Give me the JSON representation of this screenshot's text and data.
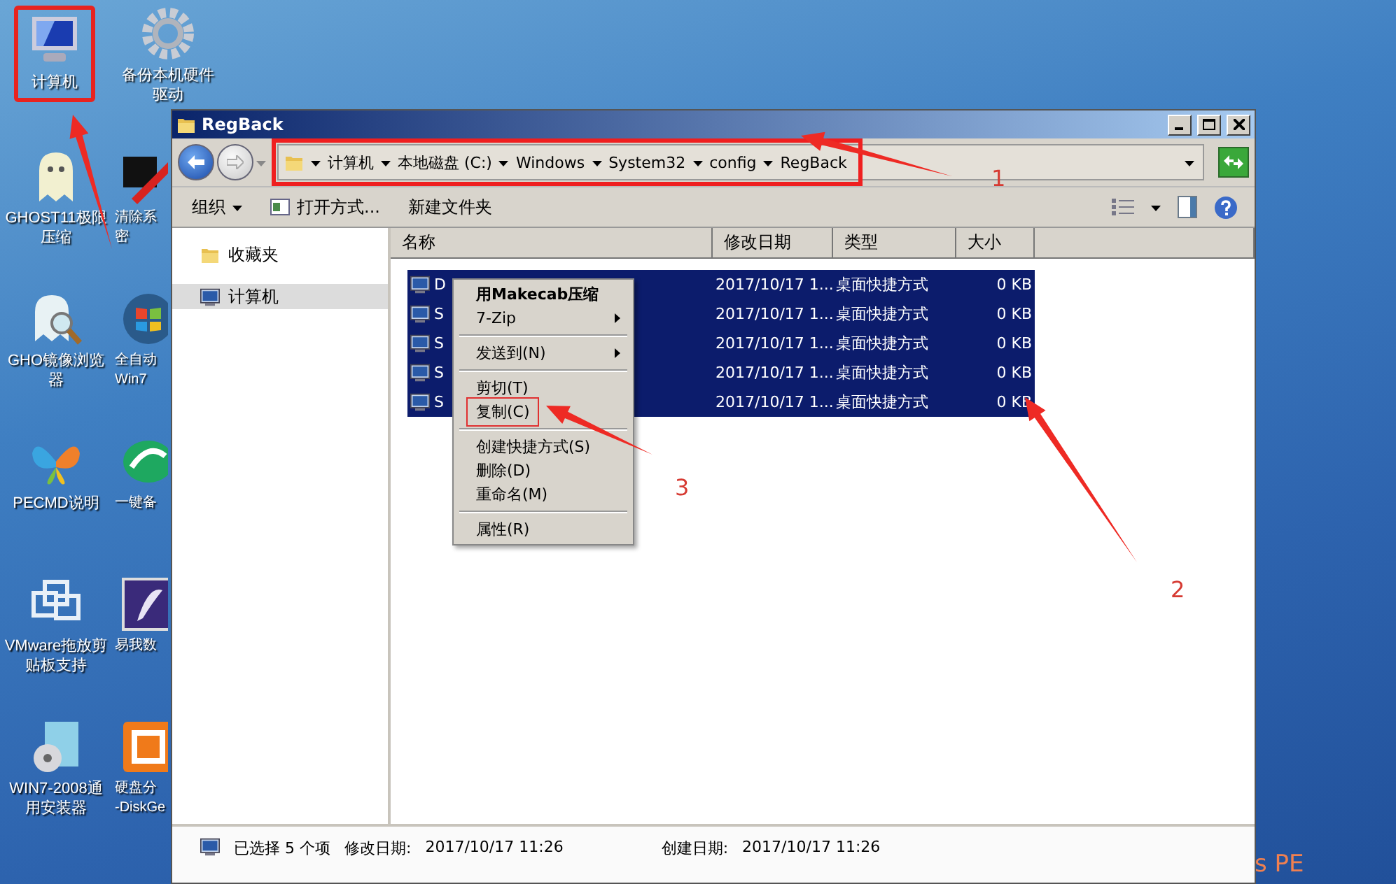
{
  "desktop": {
    "icons": [
      {
        "lines": [
          "计算机"
        ],
        "kind": "computer",
        "boxed": true
      },
      {
        "lines": [
          "GHOST11极限",
          "压缩"
        ],
        "kind": "ghost",
        "boxed": false
      },
      {
        "lines": [
          "GHO镜像浏览",
          "器"
        ],
        "kind": "ghost-search",
        "boxed": false
      },
      {
        "lines": [
          "PECMD说明"
        ],
        "kind": "butterfly",
        "boxed": false
      },
      {
        "lines": [
          "VMware拖放剪",
          "贴板支持"
        ],
        "kind": "squares",
        "boxed": false
      },
      {
        "lines": [
          "WIN7-2008通",
          "用安装器"
        ],
        "kind": "installer",
        "boxed": false
      },
      {
        "lines": [
          "备份本机硬件",
          "驱动"
        ],
        "kind": "gear",
        "boxed": false
      },
      {
        "lines": [
          "清除系",
          "密"
        ],
        "kind": "wrench",
        "boxed": false
      },
      {
        "lines": [
          "全自动",
          "Win7"
        ],
        "kind": "orb",
        "boxed": false
      },
      {
        "lines": [
          "一键备"
        ],
        "kind": "disc",
        "boxed": false
      },
      {
        "lines": [
          "易我数"
        ],
        "kind": "tile",
        "boxed": false
      },
      {
        "lines": [
          "硬盘分",
          "-DiskGe"
        ],
        "kind": "disk-tool",
        "boxed": false
      }
    ],
    "corner_text": "s PE"
  },
  "window": {
    "title": "RegBack",
    "address": {
      "boxed": true,
      "crumbs": [
        "计算机",
        "本地磁盘 (C:)",
        "Windows",
        "System32",
        "config",
        "RegBack"
      ]
    },
    "toolbar": [
      {
        "label": "组织",
        "kind": "menu"
      },
      {
        "label": "打开方式...",
        "kind": "open"
      },
      {
        "label": "新建文件夹",
        "kind": "plain"
      }
    ],
    "nav": [
      {
        "label": "收藏夹",
        "kind": "folder",
        "selected": false
      },
      {
        "label": "计算机",
        "kind": "computer",
        "selected": true
      }
    ],
    "columns": [
      "名称",
      "修改日期",
      "类型",
      "大小"
    ],
    "rows": [
      {
        "name": "D",
        "date": "2017/10/17 1...",
        "type": "桌面快捷方式",
        "size": "0 KB",
        "selected": true
      },
      {
        "name": "S",
        "date": "2017/10/17 1...",
        "type": "桌面快捷方式",
        "size": "0 KB",
        "selected": true
      },
      {
        "name": "S",
        "date": "2017/10/17 1...",
        "type": "桌面快捷方式",
        "size": "0 KB",
        "selected": true
      },
      {
        "name": "S",
        "date": "2017/10/17 1...",
        "type": "桌面快捷方式",
        "size": "0 KB",
        "selected": true
      },
      {
        "name": "S",
        "date": "2017/10/17 1...",
        "type": "桌面快捷方式",
        "size": "0 KB",
        "selected": true
      }
    ],
    "context_menu": [
      {
        "kind": "item",
        "label": "用Makecab压缩",
        "bold": true,
        "submenu": false,
        "boxed": false
      },
      {
        "kind": "item",
        "label": "7-Zip",
        "bold": false,
        "submenu": true,
        "boxed": false
      },
      {
        "kind": "separator"
      },
      {
        "kind": "item",
        "label": "发送到(N)",
        "bold": false,
        "submenu": true,
        "boxed": false
      },
      {
        "kind": "separator"
      },
      {
        "kind": "item",
        "label": "剪切(T)",
        "bold": false,
        "submenu": false,
        "boxed": false
      },
      {
        "kind": "item",
        "label": "复制(C)",
        "bold": false,
        "submenu": false,
        "boxed": true
      },
      {
        "kind": "separator"
      },
      {
        "kind": "item",
        "label": "创建快捷方式(S)",
        "bold": false,
        "submenu": false,
        "boxed": false
      },
      {
        "kind": "item",
        "label": "删除(D)",
        "bold": false,
        "submenu": false,
        "boxed": false
      },
      {
        "kind": "item",
        "label": "重命名(M)",
        "bold": false,
        "submenu": false,
        "boxed": false
      },
      {
        "kind": "separator"
      },
      {
        "kind": "item",
        "label": "属性(R)",
        "bold": false,
        "submenu": false,
        "boxed": false
      }
    ],
    "status": {
      "summary": "已选择 5 个项",
      "modified_label": "修改日期:",
      "modified": "2017/10/17 11:26",
      "created_label": "创建日期:",
      "created": "2017/10/17 11:26"
    }
  },
  "annotations": [
    "1",
    "2",
    "3"
  ]
}
